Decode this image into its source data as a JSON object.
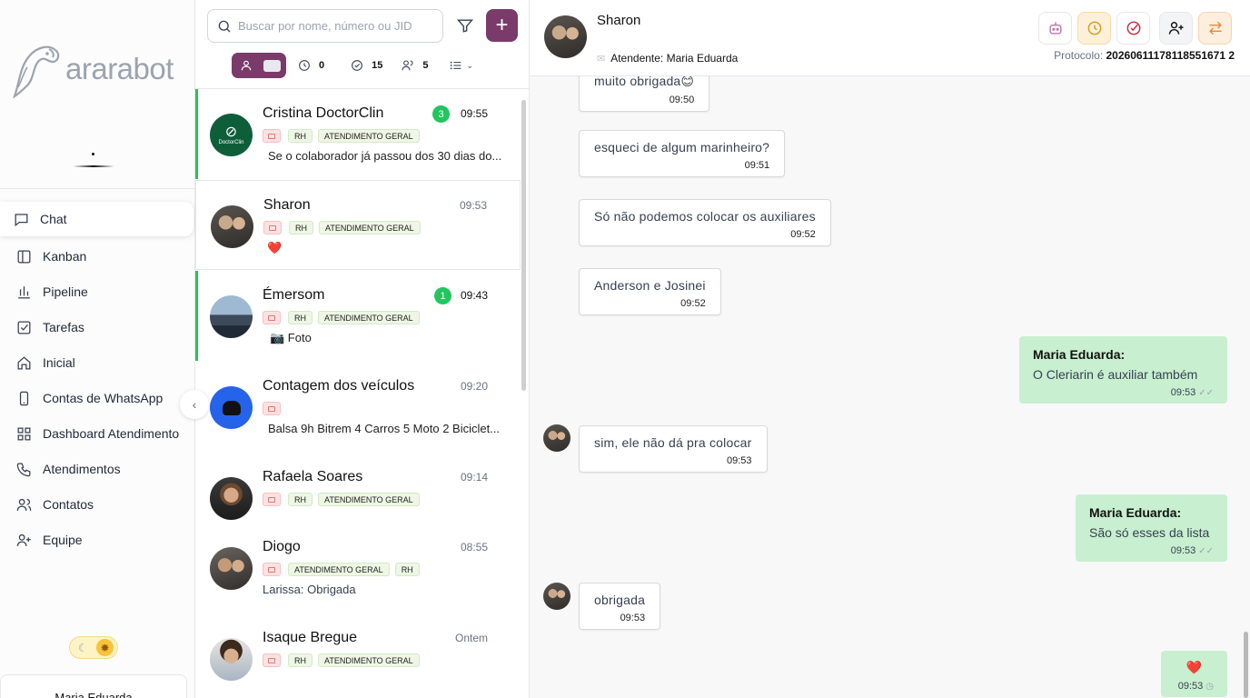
{
  "sidebar": {
    "logo_text": "ararabot",
    "nav": [
      {
        "label": "Chat",
        "icon": "chat-icon",
        "active": true
      },
      {
        "label": "Kanban",
        "icon": "kanban-icon"
      },
      {
        "label": "Pipeline",
        "icon": "chart-icon"
      },
      {
        "label": "Tarefas",
        "icon": "checkbox-icon"
      },
      {
        "label": "Inicial",
        "icon": "home-icon"
      },
      {
        "label": "Contas de WhatsApp",
        "icon": "phone-icon"
      },
      {
        "label": "Dashboard Atendimento",
        "icon": "grid-icon"
      },
      {
        "label": "Atendimentos",
        "icon": "phone-call-icon"
      },
      {
        "label": "Contatos",
        "icon": "users-icon"
      },
      {
        "label": "Equipe",
        "icon": "user-plus-icon"
      }
    ],
    "user_name": "Maria Eduarda"
  },
  "search": {
    "placeholder": "Buscar por nome, número ou JID"
  },
  "filters": {
    "pending": "0",
    "done": "15",
    "contacts": "5"
  },
  "conversations": [
    {
      "name": "Cristina DoctorClin",
      "badge": "3",
      "time": "09:55",
      "tags": [
        "RH",
        "ATENDIMENTO GERAL"
      ],
      "preview": "Se o colaborador já passou dos 30 dias do...",
      "unread": true,
      "avatar_text": "DoctorClin"
    },
    {
      "name": "Sharon",
      "badge": "",
      "time": "09:53",
      "tags": [
        "RH",
        "ATENDIMENTO GERAL"
      ],
      "preview": "❤️",
      "selected": true
    },
    {
      "name": "Émersom",
      "badge": "1",
      "time": "09:43",
      "tags": [
        "RH",
        "ATENDIMENTO GERAL"
      ],
      "preview": "📷 Foto",
      "unread": true
    },
    {
      "name": "Contagem dos veículos",
      "badge": "",
      "time": "09:20",
      "tags": [],
      "preview": "Balsa 9h Bitrem 4 Carros 5 Moto 2 Biciclet..."
    },
    {
      "name": "Rafaela Soares",
      "badge": "",
      "time": "09:14",
      "tags": [
        "RH",
        "ATENDIMENTO GERAL"
      ],
      "preview": ""
    },
    {
      "name": "Diogo",
      "badge": "",
      "time": "08:55",
      "tags": [
        "ATENDIMENTO GERAL",
        "RH"
      ],
      "preview": "Larissa: Obrigada"
    },
    {
      "name": "Isaque Bregue",
      "badge": "",
      "time": "Ontem",
      "tags": [
        "RH",
        "ATENDIMENTO GERAL"
      ],
      "preview": ""
    }
  ],
  "chat": {
    "name": "Sharon",
    "agent_label": "Atendente: Maria Eduarda",
    "protocol_label": "Protocolo:",
    "protocol": "20260611178118551671 2",
    "messages": [
      {
        "dir": "in",
        "text": "muito obrigada😊",
        "time": "09:50"
      },
      {
        "dir": "in",
        "text": "esqueci de algum marinheiro?",
        "time": "09:51"
      },
      {
        "dir": "in",
        "text": "Só não podemos colocar os auxiliares",
        "time": "09:52"
      },
      {
        "dir": "in",
        "text": "Anderson e Josinei",
        "time": "09:52"
      },
      {
        "dir": "out",
        "sender": "Maria Eduarda:",
        "text": "O Cleriarin é auxiliar também",
        "time": "09:53",
        "status": "✓✓"
      },
      {
        "dir": "in",
        "text": "sim, ele não dá pra colocar",
        "time": "09:53",
        "avatar": true
      },
      {
        "dir": "out",
        "sender": "Maria Eduarda:",
        "text": "São só esses da lista",
        "time": "09:53",
        "status": "✓✓"
      },
      {
        "dir": "in",
        "text": "obrigada",
        "time": "09:53",
        "avatar": true
      },
      {
        "dir": "out",
        "sender": "",
        "text": "❤️",
        "time": "09:53",
        "status": "◷"
      }
    ]
  },
  "colors": {
    "brand": "#7a3b6b",
    "unread": "#22c55e",
    "outgoing": "#c8efd0"
  }
}
